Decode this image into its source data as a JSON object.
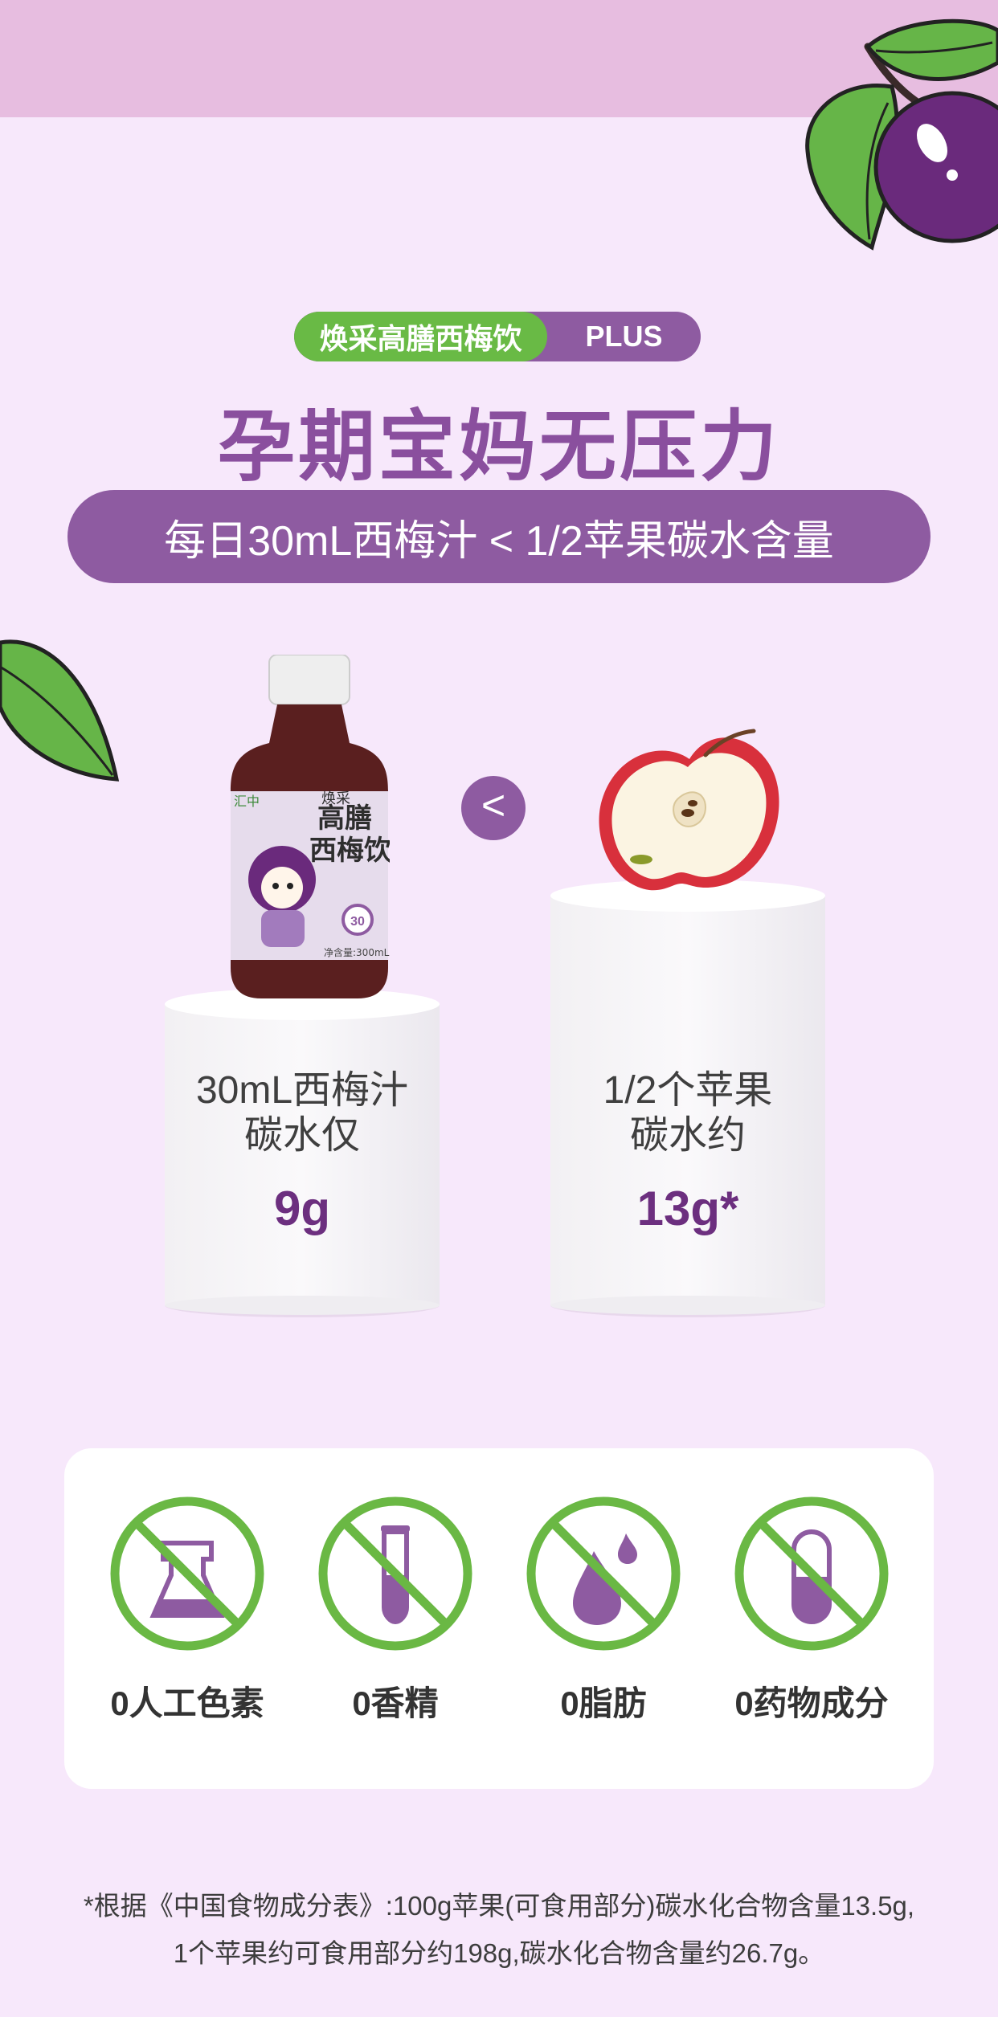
{
  "badge": {
    "brand": "焕采高膳西梅饮",
    "plus": "PLUS"
  },
  "headline": "孕期宝妈无压力",
  "subline": "每日30mL西梅汁 < 1/2苹果碳水含量",
  "compare": {
    "symbol": "<",
    "left": {
      "line1": "30mL西梅汁",
      "line2": "碳水仅",
      "value": "9g"
    },
    "right": {
      "line1": "1/2个苹果",
      "line2": "碳水约",
      "value": "13g*"
    }
  },
  "bottle": {
    "brand_corner": "汇中",
    "label_small": "焕采",
    "label_line1": "高膳",
    "label_line2": "西梅饮",
    "seal": "30",
    "net": "净含量:300mL"
  },
  "features": [
    {
      "label": "0人工色素",
      "icon": "dye-beaker-icon"
    },
    {
      "label": "0香精",
      "icon": "test-tube-icon"
    },
    {
      "label": "0脂肪",
      "icon": "oil-drop-icon"
    },
    {
      "label": "0药物成分",
      "icon": "capsule-icon"
    }
  ],
  "footnote": {
    "line1": "*根据《中国食物成分表》:100g苹果(可食用部分)碳水化合物含量13.5g,",
    "line2": "1个苹果约可食用部分约198g,碳水化合物含量约26.7g。"
  },
  "colors": {
    "background": "#f7e8fb",
    "top_band": "#e7bde0",
    "purple": "#8e5ba1",
    "headline": "#8a4f9e",
    "green": "#69ba45",
    "value": "#6c2f7f"
  }
}
